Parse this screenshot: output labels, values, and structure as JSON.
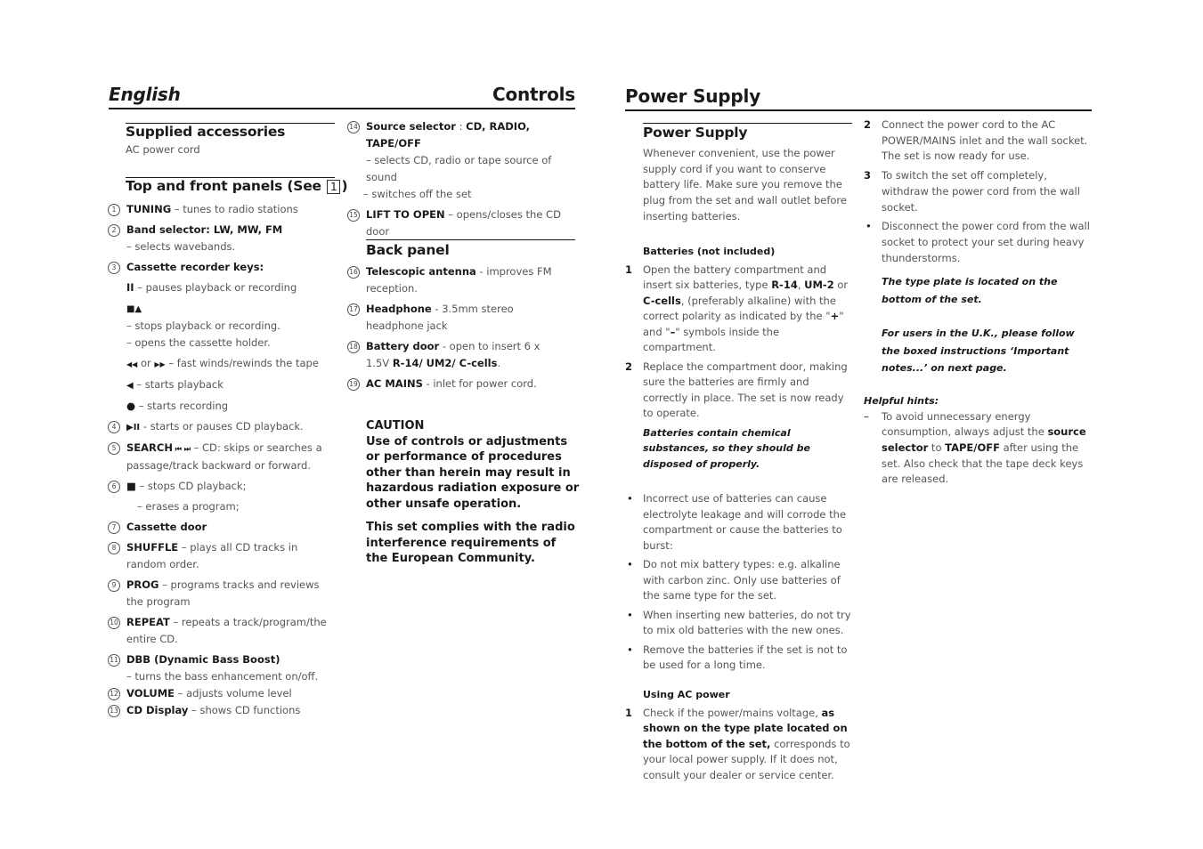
{
  "left_page": {
    "header_left": "English",
    "header_right": "Controls",
    "supplied": {
      "title": "Supplied accessories",
      "text": "AC power cord"
    },
    "panels": {
      "title": "Top and front panels (See ",
      "box": "1",
      "title_end": ")",
      "items": [
        {
          "n": "1",
          "bold": "TUNING",
          "text": " – tunes to radio stations"
        },
        {
          "n": "2",
          "bold": "Band selector: LW, MW, FM",
          "sub": "– selects wavebands."
        },
        {
          "n": "3",
          "bold": "Cassette recorder keys:"
        },
        {
          "n": "4",
          "sym": "▶II",
          "text": " - starts or pauses CD playback."
        },
        {
          "n": "5",
          "bold": "SEARCH",
          "sym": " ⏮ ⏭",
          "text": " – CD: skips or searches a passage/track backward or forward."
        },
        {
          "n": "6",
          "sym": "■",
          "text": " – stops CD playback;",
          "sub": "– erases a program;"
        },
        {
          "n": "7",
          "bold": "Cassette door"
        },
        {
          "n": "8",
          "bold": "SHUFFLE",
          "text": " – plays all CD tracks in random order."
        },
        {
          "n": "9",
          "bold": "PROG",
          "text": " – programs tracks and reviews the program"
        },
        {
          "n": "10",
          "bold": "REPEAT",
          "text": " – repeats a track/program/the entire CD."
        },
        {
          "n": "11",
          "bold": "DBB (Dynamic Bass Boost)",
          "sub": "– turns the bass enhancement on/off."
        },
        {
          "n": "12",
          "bold": "VOLUME",
          "text": " – adjusts volume level"
        },
        {
          "n": "13",
          "bold": "CD Display",
          "text": " – shows CD functions"
        }
      ],
      "cassette_keys": [
        {
          "sym": "II",
          "text": " – pauses playback or recording"
        },
        {
          "sym": "■▲",
          "text": ""
        },
        {
          "text": "– stops playback or recording."
        },
        {
          "text": "– opens the cassette holder."
        },
        {
          "sym": "◀◀",
          "mid": " or ",
          "sym2": "▶▶",
          "text": " – fast winds/rewinds the tape"
        },
        {
          "sym": "◀",
          "text": " – starts playback"
        },
        {
          "sym": "●",
          "text": " – starts recording"
        }
      ]
    },
    "col2": {
      "items": [
        {
          "n": "14",
          "bold": "Source selector",
          "text": " : ",
          "bold2": "CD, RADIO, TAPE/OFF",
          "sub1": "– selects CD, radio or tape source of sound",
          "sub2": "– switches off the set"
        },
        {
          "n": "15",
          "bold": "LIFT TO OPEN",
          "text": " – opens/closes the CD door"
        }
      ],
      "back_panel": {
        "title": "Back panel",
        "items": [
          {
            "n": "16",
            "bold": "Telescopic antenna",
            "text": " - improves FM reception."
          },
          {
            "n": "17",
            "bold": "Headphone",
            "text": " - 3.5mm stereo headphone jack"
          },
          {
            "n": "18",
            "bold": "Battery door",
            "text": " - open to insert 6 x 1.5V ",
            "bold2": "R-14/ UM2/ C-cells",
            "end": "."
          },
          {
            "n": "19",
            "bold": "AC MAINS",
            "text": " - inlet for power cord."
          }
        ]
      },
      "caution_title": "CAUTION",
      "caution_text": "Use of controls or adjustments or performance of procedures other than herein may result in hazardous radiation exposure or other unsafe operation.",
      "compliance": "This set complies with the radio interference requirements of the European Community."
    }
  },
  "right_page": {
    "header": "Power Supply",
    "section_title": "Power Supply",
    "intro": "Whenever convenient, use the power supply cord if you want to conserve battery life. Make sure you remove the plug from the set and wall outlet before inserting batteries.",
    "batteries_title": "Batteries (not included)",
    "battery_steps": [
      {
        "n": "1",
        "t1": "Open the battery compartment and insert six batteries, type ",
        "b1": "R-14",
        "t2": ", ",
        "b2": "UM-2",
        "t3": " or ",
        "b3": "C-cells",
        "t4": ", (preferably alkaline) with the correct polarity as indicated by the \"",
        "b4": "+",
        "t5": "\" and \"",
        "b5": "–",
        "t6": "\" symbols inside the compartment."
      },
      {
        "n": "2",
        "text": "Replace the compartment door, making sure the batteries are firmly and correctly in place. The set is now ready to operate."
      }
    ],
    "battery_warning": "Batteries contain chemical substances, so they should be disposed of properly.",
    "battery_bullets": [
      "Incorrect use of batteries can cause electrolyte leakage and will corrode the compartment or cause the batteries to burst:",
      "Do not mix battery types: e.g. alkaline with carbon zinc. Only use batteries of the same type for the set.",
      "When inserting new batteries, do not try to mix old batteries with the new ones.",
      "Remove the batteries if the set is not to be used for a long time."
    ],
    "ac_title": "Using AC power",
    "ac_step1": {
      "n": "1",
      "t1": "Check if the power/mains voltage, ",
      "b1": "as shown on the type plate located on the bottom of the set,",
      "t2": " corresponds to your local power supply. If it does not, consult your dealer or service center."
    },
    "ac_steps": [
      {
        "n": "2",
        "text": "Connect the power cord to the AC POWER/MAINS inlet and the wall socket. The set is now ready for use."
      },
      {
        "n": "3",
        "text": "To switch the set off completely, withdraw the power cord from the wall socket."
      }
    ],
    "ac_bullet": "Disconnect the power cord from the wall socket to protect your set during heavy thunderstorms.",
    "type_plate_note": "The type plate is located on the bottom of the set.",
    "uk_note": "For users in the U.K., please follow the boxed instructions ‘Important notes...’ on next page.",
    "hints_title": "Helpful hints:",
    "hint": {
      "t1": "To avoid unnecessary energy consumption, always adjust the ",
      "b1": "source selector",
      "t2": " to ",
      "b2": "TAPE/OFF",
      "t3": " after using the set. Also check that the tape deck keys are released."
    }
  }
}
